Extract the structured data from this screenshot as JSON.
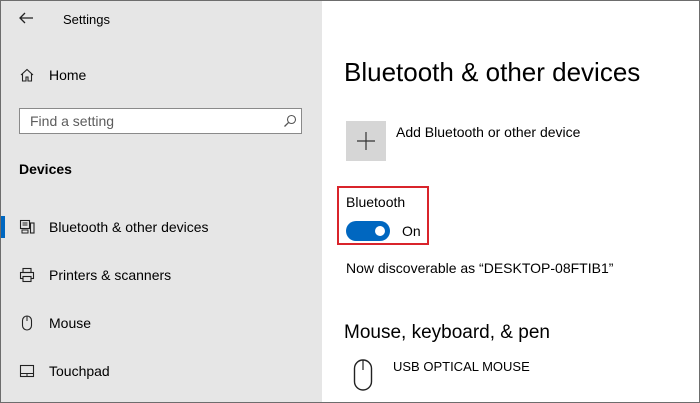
{
  "window": {
    "title": "Settings"
  },
  "sidebar": {
    "home_label": "Home",
    "search": {
      "placeholder": "Find a setting"
    },
    "section_title": "Devices",
    "items": [
      {
        "label": "Bluetooth & other devices",
        "icon": "bluetooth-devices-icon",
        "active": true
      },
      {
        "label": "Printers & scanners",
        "icon": "printer-icon",
        "active": false
      },
      {
        "label": "Mouse",
        "icon": "mouse-icon",
        "active": false
      },
      {
        "label": "Touchpad",
        "icon": "touchpad-icon",
        "active": false
      }
    ]
  },
  "main": {
    "page_title": "Bluetooth & other devices",
    "add_device_label": "Add Bluetooth or other device",
    "bluetooth": {
      "label": "Bluetooth",
      "state_label": "On",
      "enabled": true,
      "discoverable_text": "Now discoverable as “DESKTOP-08FTIB1”"
    },
    "mouse_section": {
      "title": "Mouse, keyboard, & pen",
      "devices": [
        {
          "name": "USB OPTICAL MOUSE",
          "icon": "mouse-icon"
        }
      ]
    }
  },
  "colors": {
    "accent": "#0067c0",
    "highlight_border": "#d9242b",
    "sidebar_bg": "#e6e6e6"
  }
}
